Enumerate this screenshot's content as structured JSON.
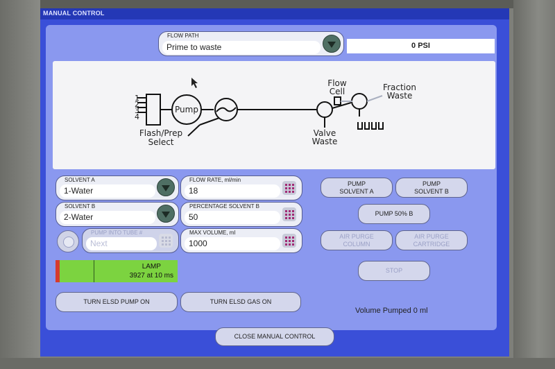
{
  "window": {
    "title": "MANUAL CONTROL"
  },
  "flow_path": {
    "label": "FLOW PATH",
    "value": "Prime to waste"
  },
  "pressure": {
    "value": "0 PSI"
  },
  "diagram": {
    "ports": [
      "1",
      "2",
      "3",
      "4"
    ],
    "pump_label": "Pump",
    "flash_prep_label": [
      "Flash/Prep",
      "Select"
    ],
    "flow_cell_label": [
      "Flow",
      "Cell"
    ],
    "fraction_waste_label": [
      "Fraction",
      "Waste"
    ],
    "valve_waste_label": [
      "Valve",
      "Waste"
    ]
  },
  "solvent_a": {
    "label": "SOLVENT A",
    "value": "1-Water"
  },
  "solvent_b": {
    "label": "SOLVENT B",
    "value": "2-Water"
  },
  "flow_rate": {
    "label": "FLOW RATE, ml/min",
    "value": "18"
  },
  "percentage_solvent_b": {
    "label": "PERCENTAGE SOLVENT B",
    "value": "50"
  },
  "max_volume": {
    "label": "MAX VOLUME, ml",
    "value": "1000"
  },
  "pump_into_tube": {
    "label": "PUMP INTO TUBE #",
    "value": "Next"
  },
  "buttons": {
    "pump_solvent_a": [
      "PUMP",
      "SOLVENT A"
    ],
    "pump_solvent_b": [
      "PUMP",
      "SOLVENT B"
    ],
    "pump_50b": "PUMP 50% B",
    "air_purge_column": [
      "AIR PURGE",
      "COLUMN"
    ],
    "air_purge_cartridge": [
      "AIR PURGE",
      "CARTRIDGE"
    ],
    "stop": "STOP",
    "turn_elsd_pump_on": "TURN ELSD PUMP ON",
    "turn_elsd_gas_on": "TURN ELSD GAS ON",
    "close_manual_control": "CLOSE MANUAL CONTROL"
  },
  "lamp": {
    "label": "LAMP",
    "value": "3927 at 10 ms"
  },
  "volume_pumped": "Volume Pumped 0 ml",
  "colors": {
    "screen_blue": "#3a4fd8",
    "panel": "#8a98ef",
    "lamp_green": "#7cd340",
    "lamp_red": "#d63a2e"
  }
}
